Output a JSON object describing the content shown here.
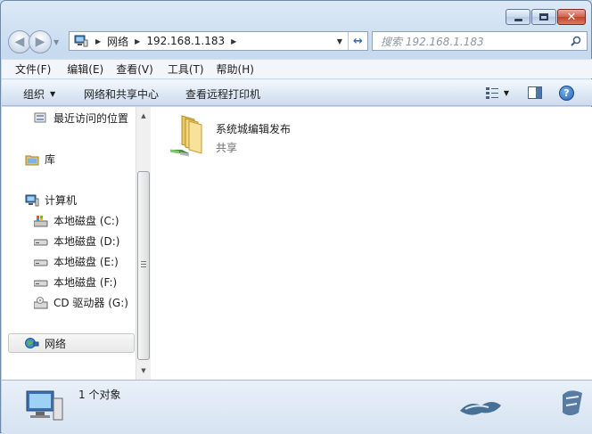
{
  "window": {
    "caption": {
      "minimize": "minimize",
      "maximize": "maximize",
      "close": "✕"
    }
  },
  "address": {
    "segments": [
      "网络",
      "192.168.1.183"
    ]
  },
  "search": {
    "placeholder": "搜索 192.168.1.183"
  },
  "menu": [
    "文件(F)",
    "编辑(E)",
    "查看(V)",
    "工具(T)",
    "帮助(H)"
  ],
  "commands": {
    "organize": "组织",
    "network_center": "网络和共享中心",
    "printers": "查看远程打印机"
  },
  "navpane": {
    "recent": "最近访问的位置",
    "libraries": "库",
    "computer": "计算机",
    "drives": [
      "本地磁盘 (C:)",
      "本地磁盘 (D:)",
      "本地磁盘 (E:)",
      "本地磁盘 (F:)",
      "CD 驱动器 (G:)"
    ],
    "network": "网络"
  },
  "content": {
    "items": [
      {
        "name": "系统城编辑发布",
        "type": "共享",
        "icon": "shared-folder-icon"
      }
    ]
  },
  "status": {
    "count": "1 个对象"
  },
  "colors": {
    "accent": "#3b6db5",
    "chrome": "#c7daee",
    "selection": "#e8e8e8"
  }
}
